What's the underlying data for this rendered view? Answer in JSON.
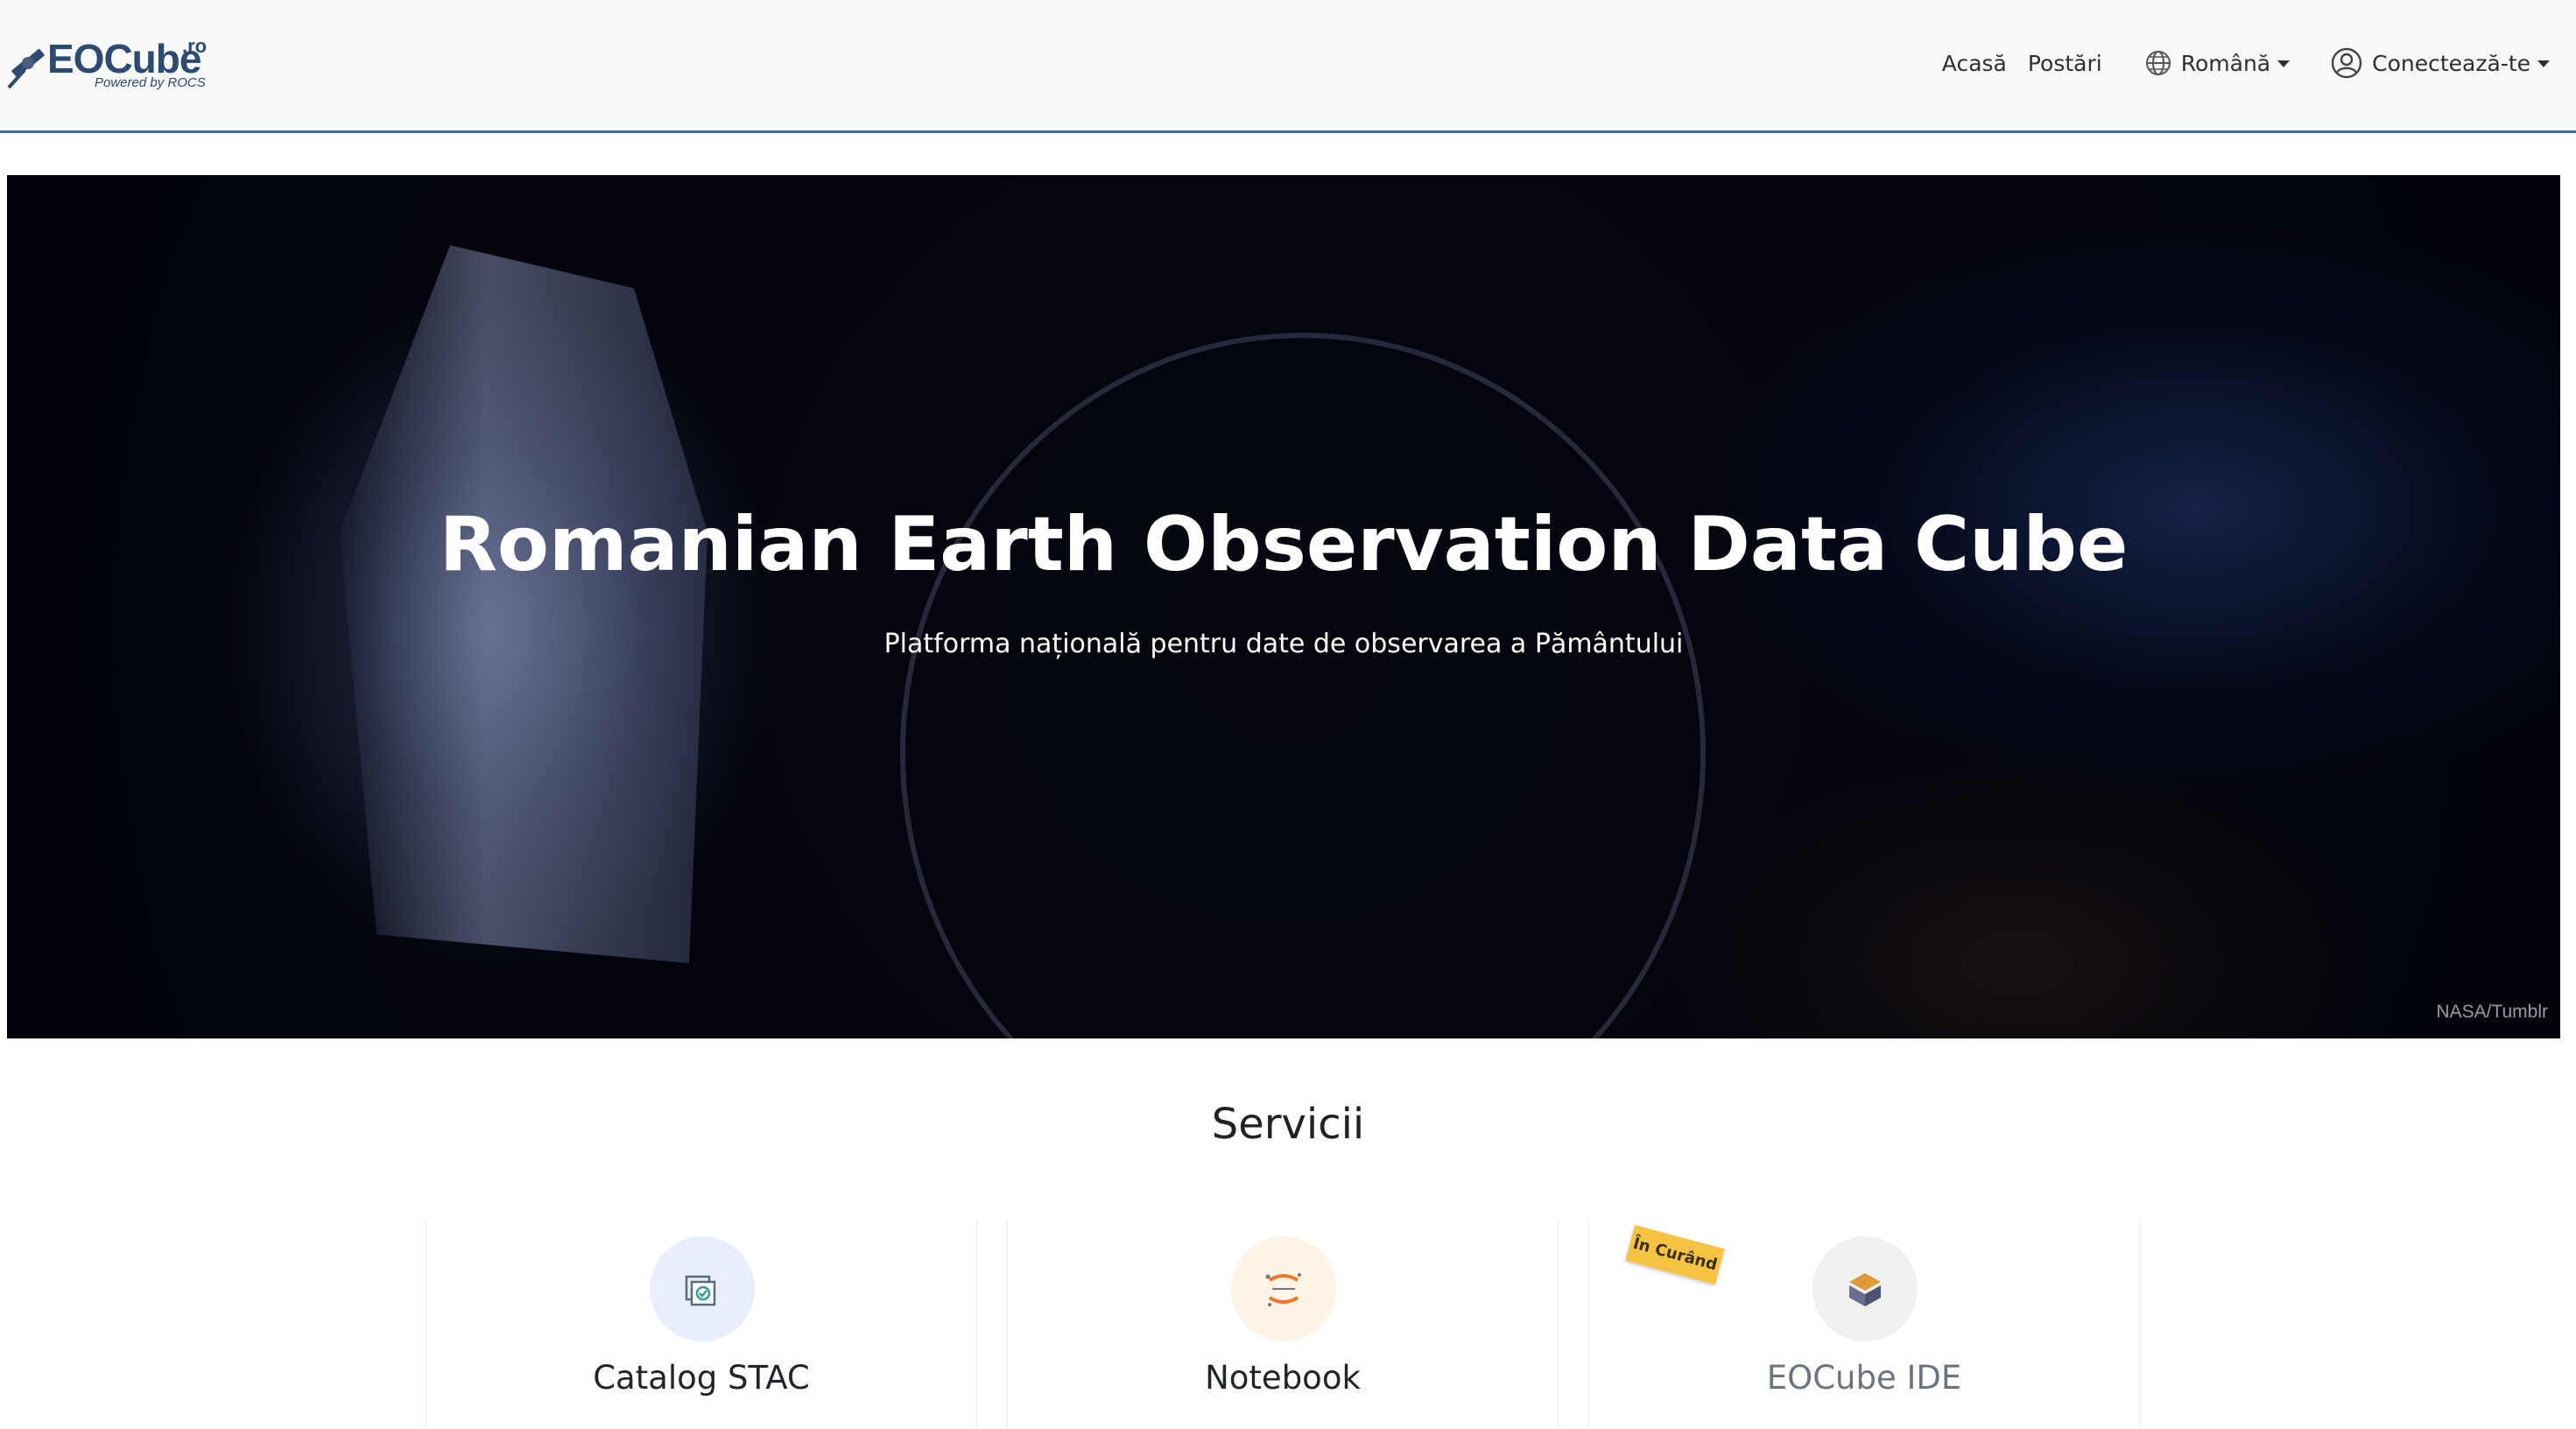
{
  "header": {
    "brand": {
      "name": "EOCube",
      "tld": ".ro",
      "tagline": "Powered by ROCS"
    },
    "nav": {
      "home": "Acasă",
      "posts": "Postări"
    },
    "language": {
      "selected": "Română",
      "icon": "globe-icon"
    },
    "user": {
      "label": "Conectează-te",
      "icon": "user-circle-icon"
    },
    "accent_color": "#3a6fb5"
  },
  "hero": {
    "title": "Romanian Earth Observation Data Cube",
    "subtitle": "Platforma națională pentru date de observarea a Pământului",
    "credit": "NASA/Tumblr"
  },
  "services": {
    "title": "Servicii",
    "items": [
      {
        "label": "Catalog STAC",
        "icon": "catalog-stac-icon",
        "icon_bg": "#e8eefb"
      },
      {
        "label": "Notebook",
        "icon": "jupyter-icon",
        "icon_bg": "#fdf3e6"
      },
      {
        "label": "EOCube IDE",
        "icon": "eocube-ide-icon",
        "icon_bg": "#eef1ee",
        "badge": "În Curând"
      }
    ]
  }
}
